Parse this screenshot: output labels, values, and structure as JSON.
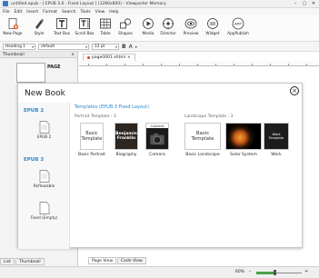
{
  "titlebar": {
    "title": "untitled.epub - [ EPUB 3.0 - Fixed Layout ] (1280x800) - Viewporter Memory",
    "minimize": "–",
    "maximize": "▢",
    "close": "✕"
  },
  "menu": [
    "File",
    "Edit",
    "Insert",
    "Format",
    "Search",
    "Tools",
    "View",
    "Help"
  ],
  "toolbar": {
    "new_page": "New Page",
    "style": "Style",
    "text_box": "Text Box",
    "scroll_box": "Scroll Box",
    "table": "Table",
    "shapes": "Shapes",
    "media": "Media",
    "director": "Director",
    "preview": "Preview",
    "widget": "Widget",
    "app_publish": "AppPublish",
    "app_icon_text": "APP"
  },
  "formatbar": {
    "heading": "Heading 1",
    "font": "default",
    "size": "12 pt",
    "bold": "B",
    "font_color_letter": "A"
  },
  "thumbnail": {
    "title": "Thumbnail",
    "close": "×",
    "page_label": "PAGE"
  },
  "editor": {
    "tab_label": "page0001.xhtml"
  },
  "dialog": {
    "title": "New Book",
    "close": "×",
    "epub2": {
      "section": "EPUB 2",
      "option": "EPUB 2"
    },
    "epub3": {
      "section": "EPUB 3",
      "reflowable": "Reflowable",
      "fixed_empty": "Fixed (Empty)"
    },
    "templates": {
      "heading": "Templates (EPUB 3 Fixed Layout)",
      "portrait_group": "Portrait Template : 3",
      "landscape_group": "Landscape Template : 3",
      "basic_thumb_line1": "Basic",
      "basic_thumb_line2": "Template",
      "biography_thumb_line1": "Benjamin",
      "biography_thumb_line2": "Franklin",
      "camera_thumb": "Camera",
      "work_thumb": "Work Template",
      "items": {
        "basic_portrait": "Basic Portrait",
        "biography": "Biography",
        "camera": "Camera",
        "basic_landscape": "Basic Landscape",
        "solar_system": "Solar System",
        "work": "Work"
      }
    }
  },
  "bottom_tabs": {
    "list": "List",
    "thumbnail": "Thumbnail"
  },
  "view_tabs": {
    "page_view": "Page View",
    "code_view": "Code View"
  },
  "status": {
    "zoom": "60%",
    "zoom_minus": "–",
    "zoom_plus": "+",
    "zoom_slider_fraction": 0.4
  },
  "colors": {
    "accent_blue": "#2e88c9",
    "zoom_green": "#49a14a"
  }
}
